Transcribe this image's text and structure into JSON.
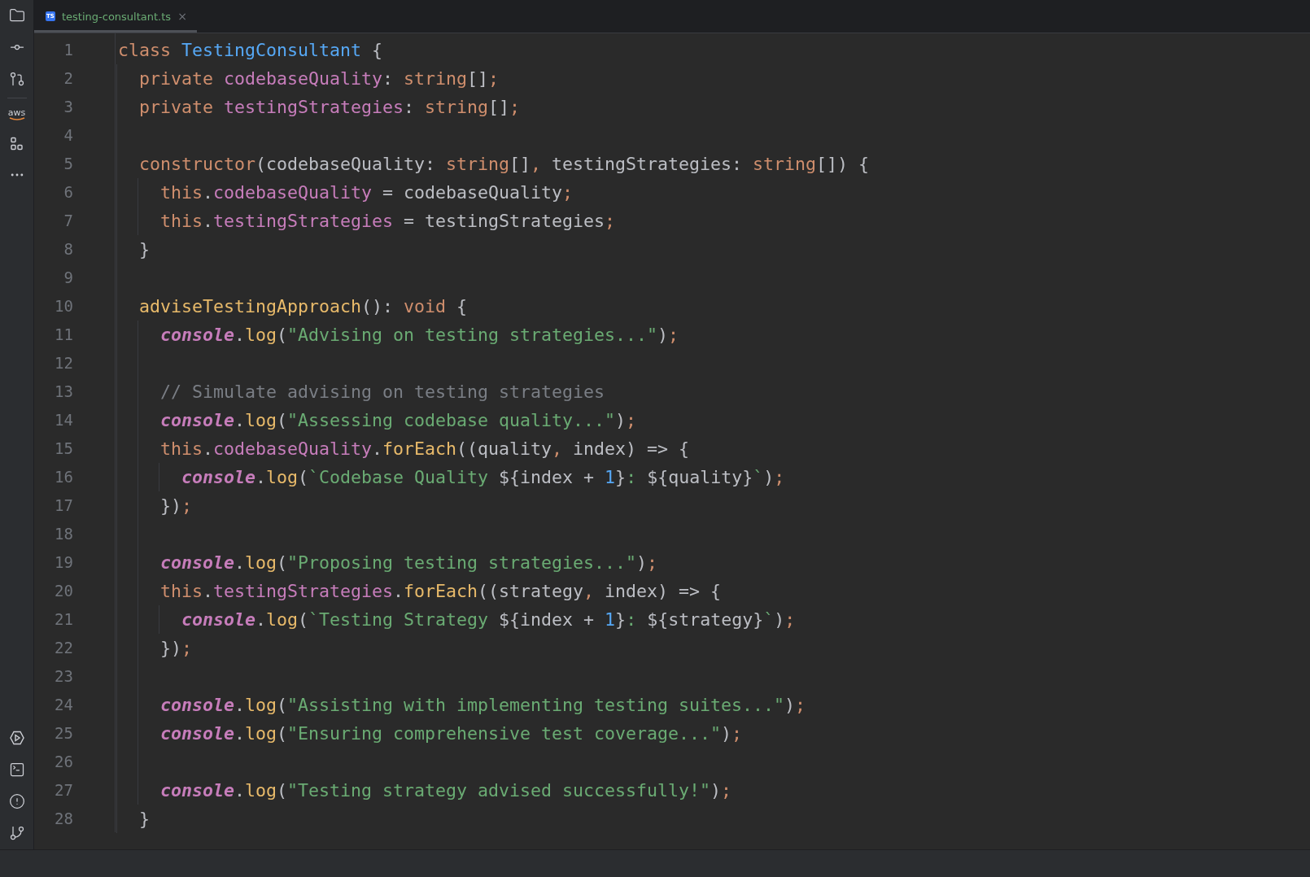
{
  "sidebar": {
    "logo_text": "aws"
  },
  "tabs": [
    {
      "badge": "TS",
      "label": "testing-consultant.ts",
      "close": "×",
      "selected": true
    }
  ],
  "lines": [
    {
      "number": "1",
      "tokens": [
        {
          "kind": "keyword",
          "text": "class "
        },
        {
          "kind": "type",
          "text": "TestingConsultant"
        },
        {
          "kind": "plain",
          "text": " {"
        }
      ],
      "children": [
        {
          "number": "2",
          "tokens": [
            {
              "kind": "keyword",
              "text": "private "
            },
            {
              "kind": "field",
              "text": "codebaseQuality"
            },
            {
              "kind": "plain",
              "text": ": "
            },
            {
              "kind": "keyword",
              "text": "string"
            },
            {
              "kind": "plain",
              "text": "[]"
            },
            {
              "kind": "keyword",
              "text": ";"
            }
          ]
        },
        {
          "number": "3",
          "tokens": [
            {
              "kind": "keyword",
              "text": "private "
            },
            {
              "kind": "field",
              "text": "testingStrategies"
            },
            {
              "kind": "plain",
              "text": ": "
            },
            {
              "kind": "keyword",
              "text": "string"
            },
            {
              "kind": "plain",
              "text": "[]"
            },
            {
              "kind": "keyword",
              "text": ";"
            }
          ]
        },
        {
          "number": "4"
        },
        {
          "number": "5",
          "tokens": [
            {
              "kind": "keyword",
              "text": "constructor"
            },
            {
              "kind": "plain",
              "text": "(codebaseQuality: "
            },
            {
              "kind": "keyword",
              "text": "string"
            },
            {
              "kind": "plain",
              "text": "[]"
            },
            {
              "kind": "keyword",
              "text": ", "
            },
            {
              "kind": "plain",
              "text": "testingStrategies: "
            },
            {
              "kind": "keyword",
              "text": "string"
            },
            {
              "kind": "plain",
              "text": "[]) {"
            }
          ],
          "children": [
            {
              "number": "6",
              "tokens": [
                {
                  "kind": "keyword",
                  "text": "this"
                },
                {
                  "kind": "plain",
                  "text": "."
                },
                {
                  "kind": "field",
                  "text": "codebaseQuality"
                },
                {
                  "kind": "plain",
                  "text": " = codebaseQuality"
                },
                {
                  "kind": "keyword",
                  "text": ";"
                }
              ]
            },
            {
              "number": "7",
              "tokens": [
                {
                  "kind": "keyword",
                  "text": "this"
                },
                {
                  "kind": "plain",
                  "text": "."
                },
                {
                  "kind": "field",
                  "text": "testingStrategies"
                },
                {
                  "kind": "plain",
                  "text": " = testingStrategies"
                },
                {
                  "kind": "keyword",
                  "text": ";"
                }
              ]
            }
          ]
        },
        {
          "number": "8",
          "tokens": [
            {
              "kind": "plain",
              "text": "}"
            }
          ]
        },
        {
          "number": "9"
        },
        {
          "number": "10",
          "tokens": [
            {
              "kind": "method",
              "text": "adviseTestingApproach"
            },
            {
              "kind": "plain",
              "text": "(): "
            },
            {
              "kind": "keyword",
              "text": "void"
            },
            {
              "kind": "plain",
              "text": " {"
            }
          ],
          "children": [
            {
              "number": "11",
              "tokens": [
                {
                  "kind": "console",
                  "text": "console"
                },
                {
                  "kind": "plain",
                  "text": "."
                },
                {
                  "kind": "method",
                  "text": "log"
                },
                {
                  "kind": "plain",
                  "text": "("
                },
                {
                  "kind": "string",
                  "text": "\"Advising on testing strategies...\""
                },
                {
                  "kind": "plain",
                  "text": ")"
                },
                {
                  "kind": "keyword",
                  "text": ";"
                }
              ]
            },
            {
              "number": "12"
            },
            {
              "number": "13",
              "tokens": [
                {
                  "kind": "comment",
                  "text": "// Simulate advising on testing strategies"
                }
              ]
            },
            {
              "number": "14",
              "tokens": [
                {
                  "kind": "console",
                  "text": "console"
                },
                {
                  "kind": "plain",
                  "text": "."
                },
                {
                  "kind": "method",
                  "text": "log"
                },
                {
                  "kind": "plain",
                  "text": "("
                },
                {
                  "kind": "string",
                  "text": "\"Assessing codebase quality...\""
                },
                {
                  "kind": "plain",
                  "text": ")"
                },
                {
                  "kind": "keyword",
                  "text": ";"
                }
              ]
            },
            {
              "number": "15",
              "tokens": [
                {
                  "kind": "keyword",
                  "text": "this"
                },
                {
                  "kind": "plain",
                  "text": "."
                },
                {
                  "kind": "field",
                  "text": "codebaseQuality"
                },
                {
                  "kind": "plain",
                  "text": "."
                },
                {
                  "kind": "method",
                  "text": "forEach"
                },
                {
                  "kind": "plain",
                  "text": "((quality"
                },
                {
                  "kind": "keyword",
                  "text": ", "
                },
                {
                  "kind": "plain",
                  "text": "index) => {"
                }
              ],
              "children": [
                {
                  "number": "16",
                  "tokens": [
                    {
                      "kind": "console",
                      "text": "console"
                    },
                    {
                      "kind": "plain",
                      "text": "."
                    },
                    {
                      "kind": "method",
                      "text": "log"
                    },
                    {
                      "kind": "plain",
                      "text": "("
                    },
                    {
                      "kind": "string",
                      "text": "`Codebase Quality "
                    },
                    {
                      "kind": "plain",
                      "text": "${index + "
                    },
                    {
                      "kind": "number",
                      "text": "1"
                    },
                    {
                      "kind": "plain",
                      "text": "}"
                    },
                    {
                      "kind": "string",
                      "text": ": "
                    },
                    {
                      "kind": "plain",
                      "text": "${quality}"
                    },
                    {
                      "kind": "string",
                      "text": "`"
                    },
                    {
                      "kind": "plain",
                      "text": ")"
                    },
                    {
                      "kind": "keyword",
                      "text": ";"
                    }
                  ]
                }
              ]
            },
            {
              "number": "17",
              "tokens": [
                {
                  "kind": "plain",
                  "text": "})"
                },
                {
                  "kind": "keyword",
                  "text": ";"
                }
              ]
            },
            {
              "number": "18"
            },
            {
              "number": "19",
              "tokens": [
                {
                  "kind": "console",
                  "text": "console"
                },
                {
                  "kind": "plain",
                  "text": "."
                },
                {
                  "kind": "method",
                  "text": "log"
                },
                {
                  "kind": "plain",
                  "text": "("
                },
                {
                  "kind": "string",
                  "text": "\"Proposing testing strategies...\""
                },
                {
                  "kind": "plain",
                  "text": ")"
                },
                {
                  "kind": "keyword",
                  "text": ";"
                }
              ]
            },
            {
              "number": "20",
              "tokens": [
                {
                  "kind": "keyword",
                  "text": "this"
                },
                {
                  "kind": "plain",
                  "text": "."
                },
                {
                  "kind": "field",
                  "text": "testingStrategies"
                },
                {
                  "kind": "plain",
                  "text": "."
                },
                {
                  "kind": "method",
                  "text": "forEach"
                },
                {
                  "kind": "plain",
                  "text": "((strategy"
                },
                {
                  "kind": "keyword",
                  "text": ", "
                },
                {
                  "kind": "plain",
                  "text": "index) => {"
                }
              ],
              "children": [
                {
                  "number": "21",
                  "tokens": [
                    {
                      "kind": "console",
                      "text": "console"
                    },
                    {
                      "kind": "plain",
                      "text": "."
                    },
                    {
                      "kind": "method",
                      "text": "log"
                    },
                    {
                      "kind": "plain",
                      "text": "("
                    },
                    {
                      "kind": "string",
                      "text": "`Testing Strategy "
                    },
                    {
                      "kind": "plain",
                      "text": "${index + "
                    },
                    {
                      "kind": "number",
                      "text": "1"
                    },
                    {
                      "kind": "plain",
                      "text": "}"
                    },
                    {
                      "kind": "string",
                      "text": ": "
                    },
                    {
                      "kind": "plain",
                      "text": "${strategy}"
                    },
                    {
                      "kind": "string",
                      "text": "`"
                    },
                    {
                      "kind": "plain",
                      "text": ")"
                    },
                    {
                      "kind": "keyword",
                      "text": ";"
                    }
                  ]
                }
              ]
            },
            {
              "number": "22",
              "tokens": [
                {
                  "kind": "plain",
                  "text": "})"
                },
                {
                  "kind": "keyword",
                  "text": ";"
                }
              ]
            },
            {
              "number": "23"
            },
            {
              "number": "24",
              "tokens": [
                {
                  "kind": "console",
                  "text": "console"
                },
                {
                  "kind": "plain",
                  "text": "."
                },
                {
                  "kind": "method",
                  "text": "log"
                },
                {
                  "kind": "plain",
                  "text": "("
                },
                {
                  "kind": "string",
                  "text": "\"Assisting with implementing testing suites...\""
                },
                {
                  "kind": "plain",
                  "text": ")"
                },
                {
                  "kind": "keyword",
                  "text": ";"
                }
              ]
            },
            {
              "number": "25",
              "tokens": [
                {
                  "kind": "console",
                  "text": "console"
                },
                {
                  "kind": "plain",
                  "text": "."
                },
                {
                  "kind": "method",
                  "text": "log"
                },
                {
                  "kind": "plain",
                  "text": "("
                },
                {
                  "kind": "string",
                  "text": "\"Ensuring comprehensive test coverage...\""
                },
                {
                  "kind": "plain",
                  "text": ")"
                },
                {
                  "kind": "keyword",
                  "text": ";"
                }
              ]
            },
            {
              "number": "26"
            },
            {
              "number": "27",
              "tokens": [
                {
                  "kind": "console",
                  "text": "console"
                },
                {
                  "kind": "plain",
                  "text": "."
                },
                {
                  "kind": "method",
                  "text": "log"
                },
                {
                  "kind": "plain",
                  "text": "("
                },
                {
                  "kind": "string",
                  "text": "\"Testing strategy advised successfully!\""
                },
                {
                  "kind": "plain",
                  "text": ")"
                },
                {
                  "kind": "keyword",
                  "text": ";"
                }
              ]
            }
          ]
        },
        {
          "number": "28",
          "tokens": [
            {
              "kind": "plain",
              "text": "}"
            }
          ]
        }
      ]
    }
  ]
}
